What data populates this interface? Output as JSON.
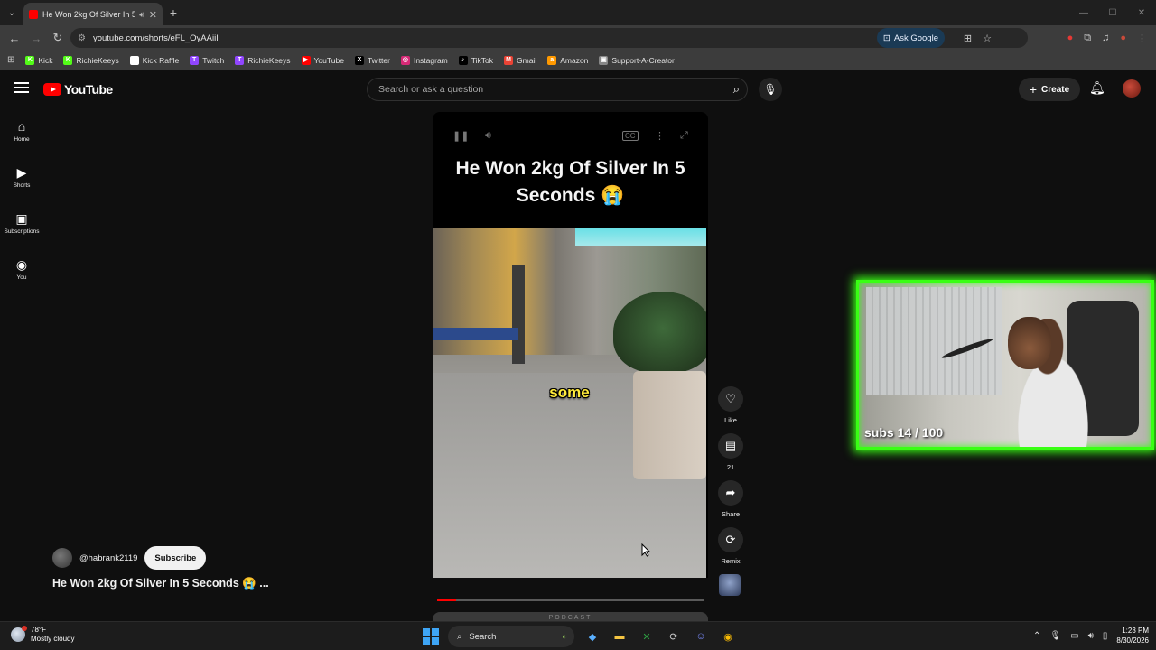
{
  "browser": {
    "tab_title": "He Won 2kg Of Silver In 5 S",
    "url": "youtube.com/shorts/eFL_OyAAiiI",
    "ask_google": "Ask Google",
    "bookmarks": [
      {
        "label": "Kick",
        "color": "#53fc18",
        "glyph": "K"
      },
      {
        "label": "RichieKeeys",
        "color": "#53fc18",
        "glyph": "K"
      },
      {
        "label": "Kick Raffle",
        "color": "#ffffff",
        "glyph": "◆"
      },
      {
        "label": "Twitch",
        "color": "#9146ff",
        "glyph": "T"
      },
      {
        "label": "RichieKeeys",
        "color": "#9146ff",
        "glyph": "T"
      },
      {
        "label": "YouTube",
        "color": "#ff0000",
        "glyph": "▶"
      },
      {
        "label": "Twitter",
        "color": "#000000",
        "glyph": "X"
      },
      {
        "label": "Instagram",
        "color": "#d62976",
        "glyph": "◎"
      },
      {
        "label": "TikTok",
        "color": "#000000",
        "glyph": "♪"
      },
      {
        "label": "Gmail",
        "color": "#ea4335",
        "glyph": "M"
      },
      {
        "label": "Amazon",
        "color": "#ff9900",
        "glyph": "a"
      },
      {
        "label": "Support-A-Creator",
        "color": "#888888",
        "glyph": "▣"
      }
    ]
  },
  "youtube": {
    "logo_text": "YouTube",
    "search_placeholder": "Search or ask a question",
    "create_label": "Create",
    "sidebar": [
      {
        "label": "Home",
        "icon": "home-icon",
        "glyph": "⌂"
      },
      {
        "label": "Shorts",
        "icon": "shorts-icon",
        "glyph": "▶"
      },
      {
        "label": "Subscriptions",
        "icon": "subscriptions-icon",
        "glyph": "▣"
      },
      {
        "label": "You",
        "icon": "you-icon",
        "glyph": "◉"
      }
    ]
  },
  "short": {
    "title_overlay": "He Won 2kg Of Silver In 5 Seconds 😭",
    "caption_word": "some",
    "progress_fraction": 0.07,
    "next_peek_text": "PODCAST",
    "actions": [
      {
        "name": "like",
        "glyph": "♡",
        "label": "Like"
      },
      {
        "name": "comments",
        "glyph": "▤",
        "label": "21"
      },
      {
        "name": "share",
        "glyph": "➦",
        "label": "Share"
      },
      {
        "name": "remix",
        "glyph": "⟳",
        "label": "Remix"
      }
    ],
    "channel_handle": "@habrank2119",
    "subscribe_label": "Subscribe",
    "video_title": "He Won 2kg Of Silver In 5 Seconds 😭  ..."
  },
  "webcam": {
    "subs_text": "subs 14 / 100",
    "border_color": "#39ff14"
  },
  "taskbar": {
    "temperature": "78°F",
    "weather": "Mostly cloudy",
    "search_label": "Search",
    "time": "1:23 PM",
    "date": "8/30/2026"
  }
}
